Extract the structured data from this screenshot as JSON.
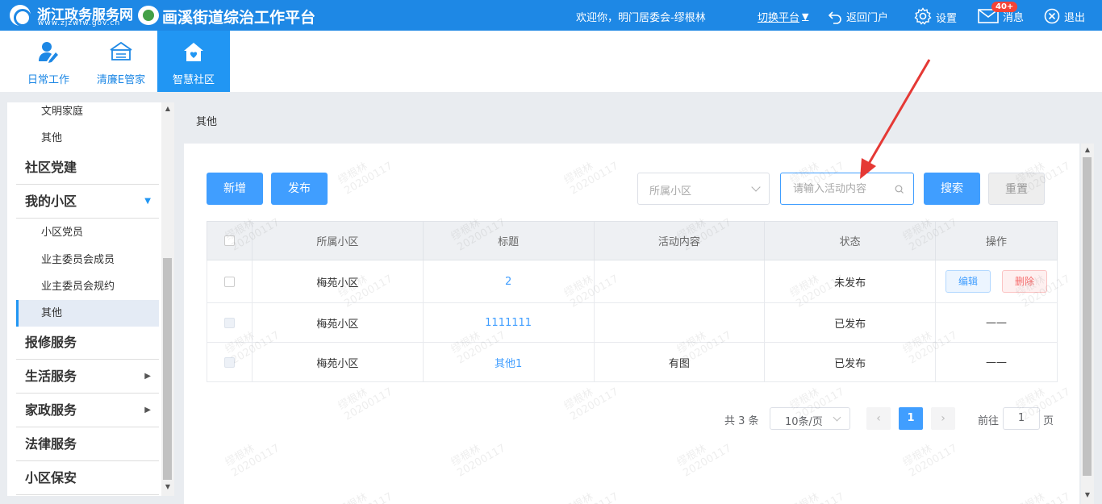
{
  "header": {
    "logo_title": "浙江政务服务网",
    "logo_url": "www.zjzwfw.gov.cn",
    "platform_title": "画溪街道综治工作平台",
    "welcome": "欢迎你，明门居委会-缪根林",
    "switch_label": "切换平台",
    "portal_label": "返回门户",
    "settings_label": "设置",
    "message_label": "消息",
    "message_badge": "40+",
    "logout_label": "退出"
  },
  "nav": {
    "tiles": [
      {
        "label": "日常工作",
        "icon": "user-pen-icon"
      },
      {
        "label": "清廉E管家",
        "icon": "building-icon"
      },
      {
        "label": "智慧社区",
        "icon": "home-heart-icon",
        "active": true
      }
    ]
  },
  "sidebar": {
    "items": [
      {
        "label": "文明家庭",
        "type": "sub"
      },
      {
        "label": "其他",
        "type": "sub"
      },
      {
        "label": "社区党建",
        "type": "main"
      },
      {
        "label": "我的小区",
        "type": "main",
        "expanded": true
      },
      {
        "label": "小区党员",
        "type": "sub"
      },
      {
        "label": "业主委员会成员",
        "type": "sub"
      },
      {
        "label": "业主委员会规约",
        "type": "sub"
      },
      {
        "label": "其他",
        "type": "sub",
        "active": true
      },
      {
        "label": "报修服务",
        "type": "main"
      },
      {
        "label": "生活服务",
        "type": "main"
      },
      {
        "label": "家政服务",
        "type": "main"
      },
      {
        "label": "法律服务",
        "type": "main"
      },
      {
        "label": "小区保安",
        "type": "main"
      }
    ]
  },
  "breadcrumb": "其他",
  "toolbar": {
    "add_label": "新增",
    "publish_label": "发布",
    "community_placeholder": "所属小区",
    "search_placeholder": "请输入活动内容",
    "search_label": "搜索",
    "reset_label": "重置"
  },
  "table": {
    "headers": [
      "所属小区",
      "标题",
      "活动内容",
      "状态",
      "操作"
    ],
    "rows": [
      {
        "community": "梅苑小区",
        "title": "2",
        "content": "",
        "status": "未发布",
        "actions": [
          "编辑",
          "删除"
        ]
      },
      {
        "community": "梅苑小区",
        "title": "1111111",
        "content": "",
        "status": "已发布",
        "actions_text": "——"
      },
      {
        "community": "梅苑小区",
        "title": "其他1",
        "content": "有图",
        "status": "已发布",
        "actions_text": "——"
      }
    ]
  },
  "pagination": {
    "total": "共 3 条",
    "page_size": "10条/页",
    "current_page": "1",
    "goto_label": "前往",
    "goto_value": "1",
    "page_suffix": "页"
  },
  "watermark": {
    "name": "缪根林",
    "code": "20200117"
  },
  "colors": {
    "header": "#1e88e5",
    "primary": "#409eff",
    "active_tile": "#2196f3",
    "arrow": "#e53935"
  }
}
